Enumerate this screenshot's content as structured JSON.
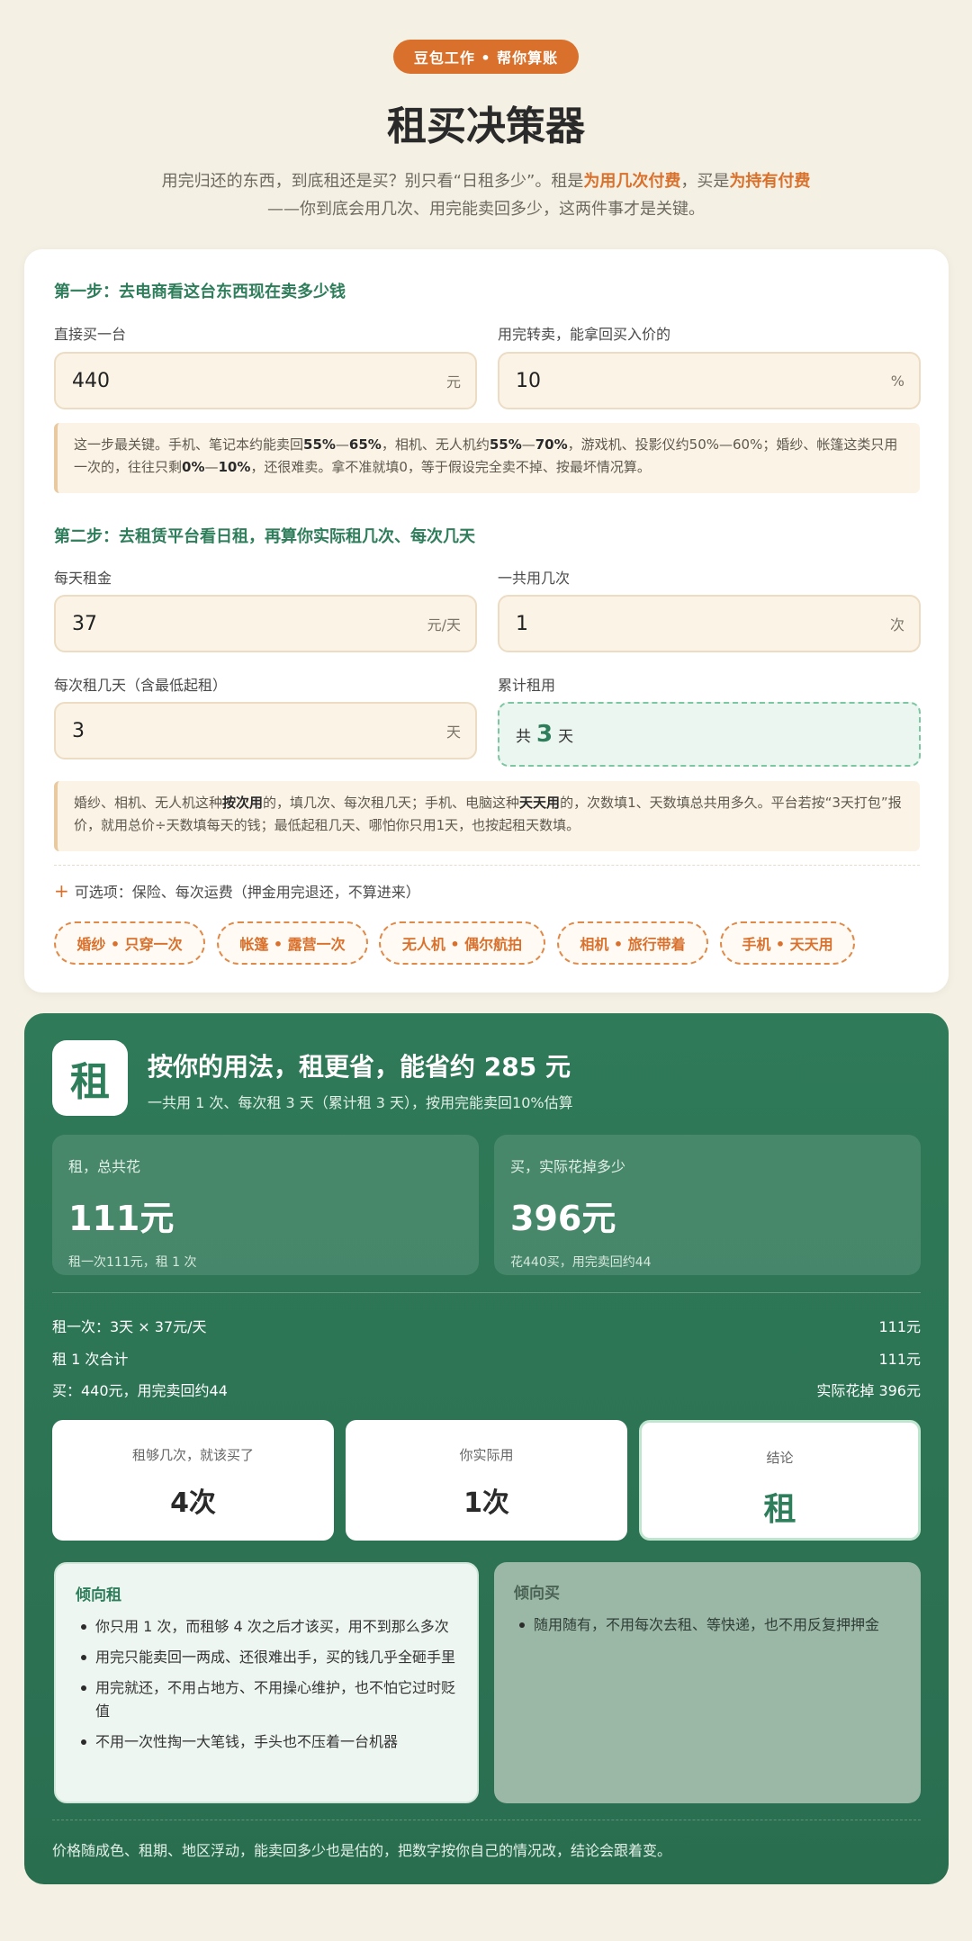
{
  "header": {
    "badge": "豆包工作 • 帮你算账",
    "title": "租买决策器",
    "subtitle_line1_a": "用完归还的东西，到底租还是买？别只看“日租多少”。租是",
    "subtitle_hl1": "为用几次付费",
    "subtitle_line1_b": "，买是",
    "subtitle_hl2": "为持有付费",
    "subtitle_line2": "——你到底会用几次、用完能卖回多少，这两件事才是关键。"
  },
  "step1": {
    "title": "第一步：去电商看这台东西现在卖多少钱",
    "buy_price_label": "直接买一台",
    "buy_price_value": "440",
    "buy_price_unit": "元",
    "resale_label": "用完转卖，能拿回买入价的",
    "resale_value": "10",
    "resale_unit": "%",
    "note_a": "这一步最关键。手机、笔记本约能卖回",
    "note_b1": "55%",
    "note_c": "—",
    "note_b2": "65%",
    "note_d": "，相机、无人机约",
    "note_b3": "55%",
    "note_e": "—",
    "note_b4": "70%",
    "note_f": "，游戏机、投影仪约50%—60%；婚纱、帐篷这类只用一次的，往往只剩",
    "note_b5": "0%",
    "note_g": "—",
    "note_b6": "10%",
    "note_h": "，还很难卖。拿不准就填0，等于假设完全卖不掉、按最坏情况算。"
  },
  "step2": {
    "title": "第二步：去租赁平台看日租，再算你实际租几次、每次几天",
    "daily_label": "每天租金",
    "daily_value": "37",
    "daily_unit": "元/天",
    "times_label": "一共用几次",
    "times_value": "1",
    "times_unit": "次",
    "days_label": "每次租几天（含最低起租）",
    "days_value": "3",
    "days_unit": "天",
    "total_label": "累计租用",
    "total_prefix": "共",
    "total_value": "3",
    "total_unit": "天",
    "note_a": "婚纱、相机、无人机这种",
    "note_b1": "按次用",
    "note_c": "的，填几次、每次租几天；手机、电脑这种",
    "note_b2": "天天用",
    "note_d": "的，次数填1、天数填总共用多久。平台若按“3天打包”报价，就用总价÷天数填每天的钱；最低起租几天、哪怕你只用1天，也按起租天数填。",
    "optional": "可选项：保险、每次运费（押金用完退还，不算进来）",
    "presets": [
      "婚纱 • 只穿一次",
      "帐篷 • 露营一次",
      "无人机 • 偶尔航拍",
      "相机 • 旅行带着",
      "手机 • 天天用"
    ]
  },
  "result": {
    "logo": "租",
    "headline": "按你的用法，租更省，能省约 285 元",
    "subhead": "一共用 1 次、每次租 3 天（累计租 3 天），按用完能卖回10%估算",
    "rent_caption": "租，总共花",
    "rent_total": "111元",
    "rent_detail": "租一次111元，租 1 次",
    "buy_caption": "买，实际花掉多少",
    "buy_total": "396元",
    "buy_detail": "花440买，用完卖回约44",
    "rows": [
      {
        "label": "租一次：3天 × 37元/天",
        "value": "111元"
      },
      {
        "label": "租 1 次合计",
        "value": "111元"
      },
      {
        "label": "买：440元，用完卖回约44",
        "value": "实际花掉 396元"
      }
    ],
    "breakeven_caption": "租够几次，就该买了",
    "breakeven_value": "4次",
    "actual_caption": "你实际用",
    "actual_value": "1次",
    "verdict_caption": "结论",
    "verdict_value": "租",
    "lean_rent_title": "倾向租",
    "lean_rent_items": [
      "你只用 1 次，而租够 4 次之后才该买，用不到那么多次",
      "用完只能卖回一两成、还很难出手，买的钱几乎全砸手里",
      "用完就还，不用占地方、不用操心维护，也不怕它过时贬值",
      "不用一次性掏一大笔钱，手头也不压着一台机器"
    ],
    "lean_buy_title": "倾向买",
    "lean_buy_items": [
      "随用随有，不用每次去租、等快递，也不用反复押押金"
    ],
    "footnote": "价格随成色、租期、地区浮动，能卖回多少也是估的，把数字按你自己的情况改，结论会跟着变。"
  }
}
